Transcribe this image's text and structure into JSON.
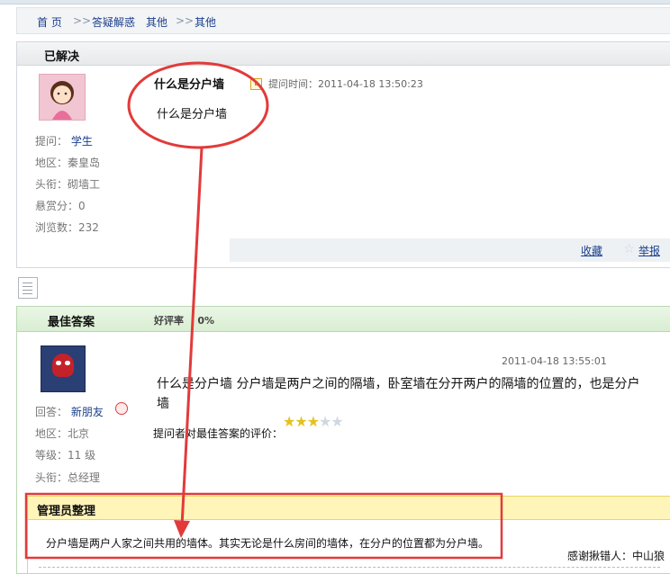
{
  "breadcrumb": {
    "home": "首 页",
    "sep1": ">>",
    "cat1": "答疑解惑",
    "cat2": "其他",
    "sep2": ">>",
    "cat3": "其他"
  },
  "question": {
    "status": "已解决",
    "title": "什么是分户墙",
    "time_label": "提问时间：",
    "time": "2011-04-18 13:50:23",
    "body": "什么是分户墙",
    "asker_label": "提问：",
    "asker": "学生",
    "region": "地区：秦皇岛",
    "rank": "头衔：砌墙工",
    "bounty": "悬赏分：0",
    "views": "浏览数：232",
    "favorite": "收藏",
    "report": "举报"
  },
  "answer": {
    "header": "最佳答案",
    "rating_label": "好评率",
    "rating_value": "0%",
    "time": "2011-04-18 13:55:01",
    "body": "什么是分户墙  分户墙是两户之间的隔墙，卧室墙在分开两户的隔墙的位置的，也是分户墙",
    "evaluation_label": "提问者对最佳答案的评价：",
    "stars": 3,
    "star_max": 5,
    "answerer_label": "回答：",
    "answerer": "新朋友",
    "region": "地区：北京",
    "level": "等级：11 级",
    "rank": "头衔：总经理"
  },
  "admin": {
    "header": "管理员整理",
    "body": "分户墙是两户人家之间共用的墙体。其实无论是什么房间的墙体，在分户的位置都为分户墙。",
    "thanks": "感谢揪错人：中山狼"
  },
  "colors": {
    "annotation": "#e23a3a",
    "link": "#1a3e8c"
  }
}
